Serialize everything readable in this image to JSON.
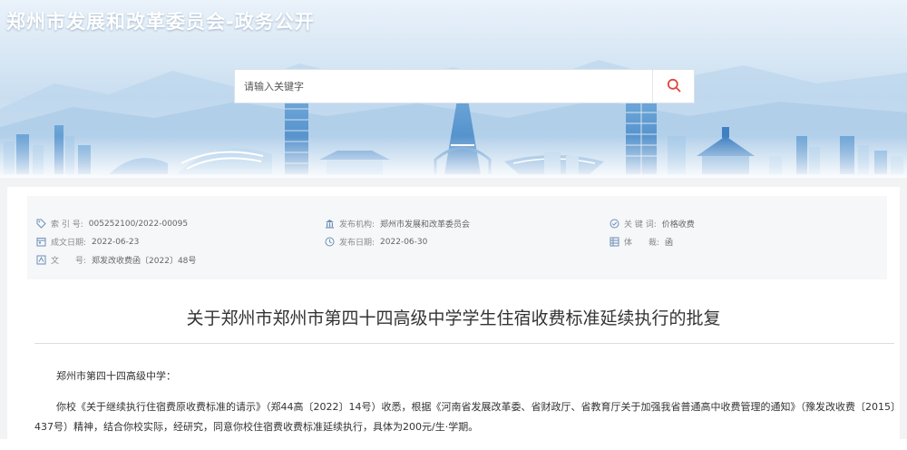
{
  "header": {
    "site_title": "郑州市发展和改革委员会-政务公开",
    "search": {
      "placeholder": "请输入关键字",
      "value": ""
    }
  },
  "meta": {
    "index_label": "索 引 号:",
    "index_value": "005252100/2022-00095",
    "publisher_label": "发布机构:",
    "publisher_value": "郑州市发展和改革委员会",
    "keywords_label": "关 键 词:",
    "keywords_value": "价格收费",
    "created_label": "成文日期:",
    "created_value": "2022-06-23",
    "published_label": "发布日期:",
    "published_value": "2022-06-30",
    "genre_label": "体　　裁:",
    "genre_value": "函",
    "docno_label": "文　　号:",
    "docno_value": "郑发改收费函〔2022〕48号"
  },
  "document": {
    "title": "关于郑州市郑州市第四十四高级中学学生住宿收费标准延续执行的批复",
    "salutation": "郑州市第四十四高级中学：",
    "paragraph": "你校《关于继续执行住宿费原收费标准的请示》（郑44高〔2022〕14号）收悉，根据《河南省发展改革委、省财政厅、省教育厅关于加强我省普通高中收费管理的通知》（豫发改收费〔2015〕437号）精神，结合你校实际，经研究，同意你校住宿费收费标准延续执行，具体为200元/生·学期。"
  },
  "colors": {
    "title_text": "#ffffff",
    "search_icon": "#e0463f",
    "meta_bg": "#f6f7f8",
    "page_bg": "#f2f3f5"
  },
  "icons": [
    "search-icon",
    "tag-icon",
    "building-icon",
    "check-circle-icon",
    "calendar-icon",
    "clock-icon",
    "grid-icon",
    "document-icon"
  ]
}
